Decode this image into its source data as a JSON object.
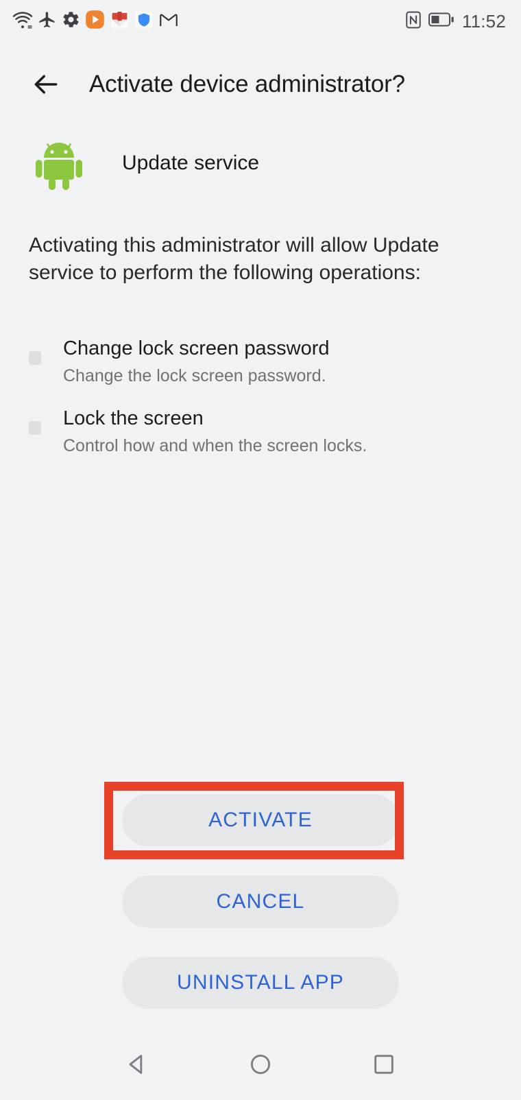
{
  "status_bar": {
    "left_icons": [
      {
        "name": "wifi-icon",
        "label": "Wi-Fi"
      },
      {
        "name": "airplane-mode-icon",
        "label": "Airplane mode"
      },
      {
        "name": "settings-gear-icon",
        "label": "Settings"
      },
      {
        "name": "media-player-icon",
        "label": "Media player",
        "color": "#EE8432"
      },
      {
        "name": "red-app-icon",
        "label": "Red app",
        "color": "#D94438"
      },
      {
        "name": "shield-icon",
        "label": "Security shield",
        "color": "#3C8DF0"
      },
      {
        "name": "gmail-icon",
        "label": "Gmail"
      }
    ],
    "right_icons": [
      {
        "name": "nfc-icon",
        "label": "NFC"
      },
      {
        "name": "battery-icon",
        "label": "Battery",
        "level_percent": 45
      }
    ],
    "time": "11:52"
  },
  "titlebar": {
    "back_label": "Back",
    "title": "Activate device administrator?"
  },
  "app": {
    "icon_name": "android-robot-icon",
    "icon_color": "#8DC63F",
    "name": "Update service"
  },
  "description": "Activating this administrator will allow Update service to perform the following operations:",
  "permissions": [
    {
      "title": "Change lock screen password",
      "subtitle": "Change the lock screen password."
    },
    {
      "title": "Lock the screen",
      "subtitle": "Control how and when the screen locks."
    }
  ],
  "buttons": {
    "activate": "ACTIVATE",
    "cancel": "CANCEL",
    "uninstall": "UNINSTALL APP",
    "highlight_color": "#E8412A",
    "text_color": "#2E63D6",
    "fill_color": "#E6E7E9"
  },
  "navbar": {
    "back": "Back",
    "home": "Home",
    "recents": "Recent apps"
  },
  "theme": {
    "background": "#F1F2F4",
    "primary_text": "#1B1C1E",
    "secondary_text": "#6E7276"
  }
}
